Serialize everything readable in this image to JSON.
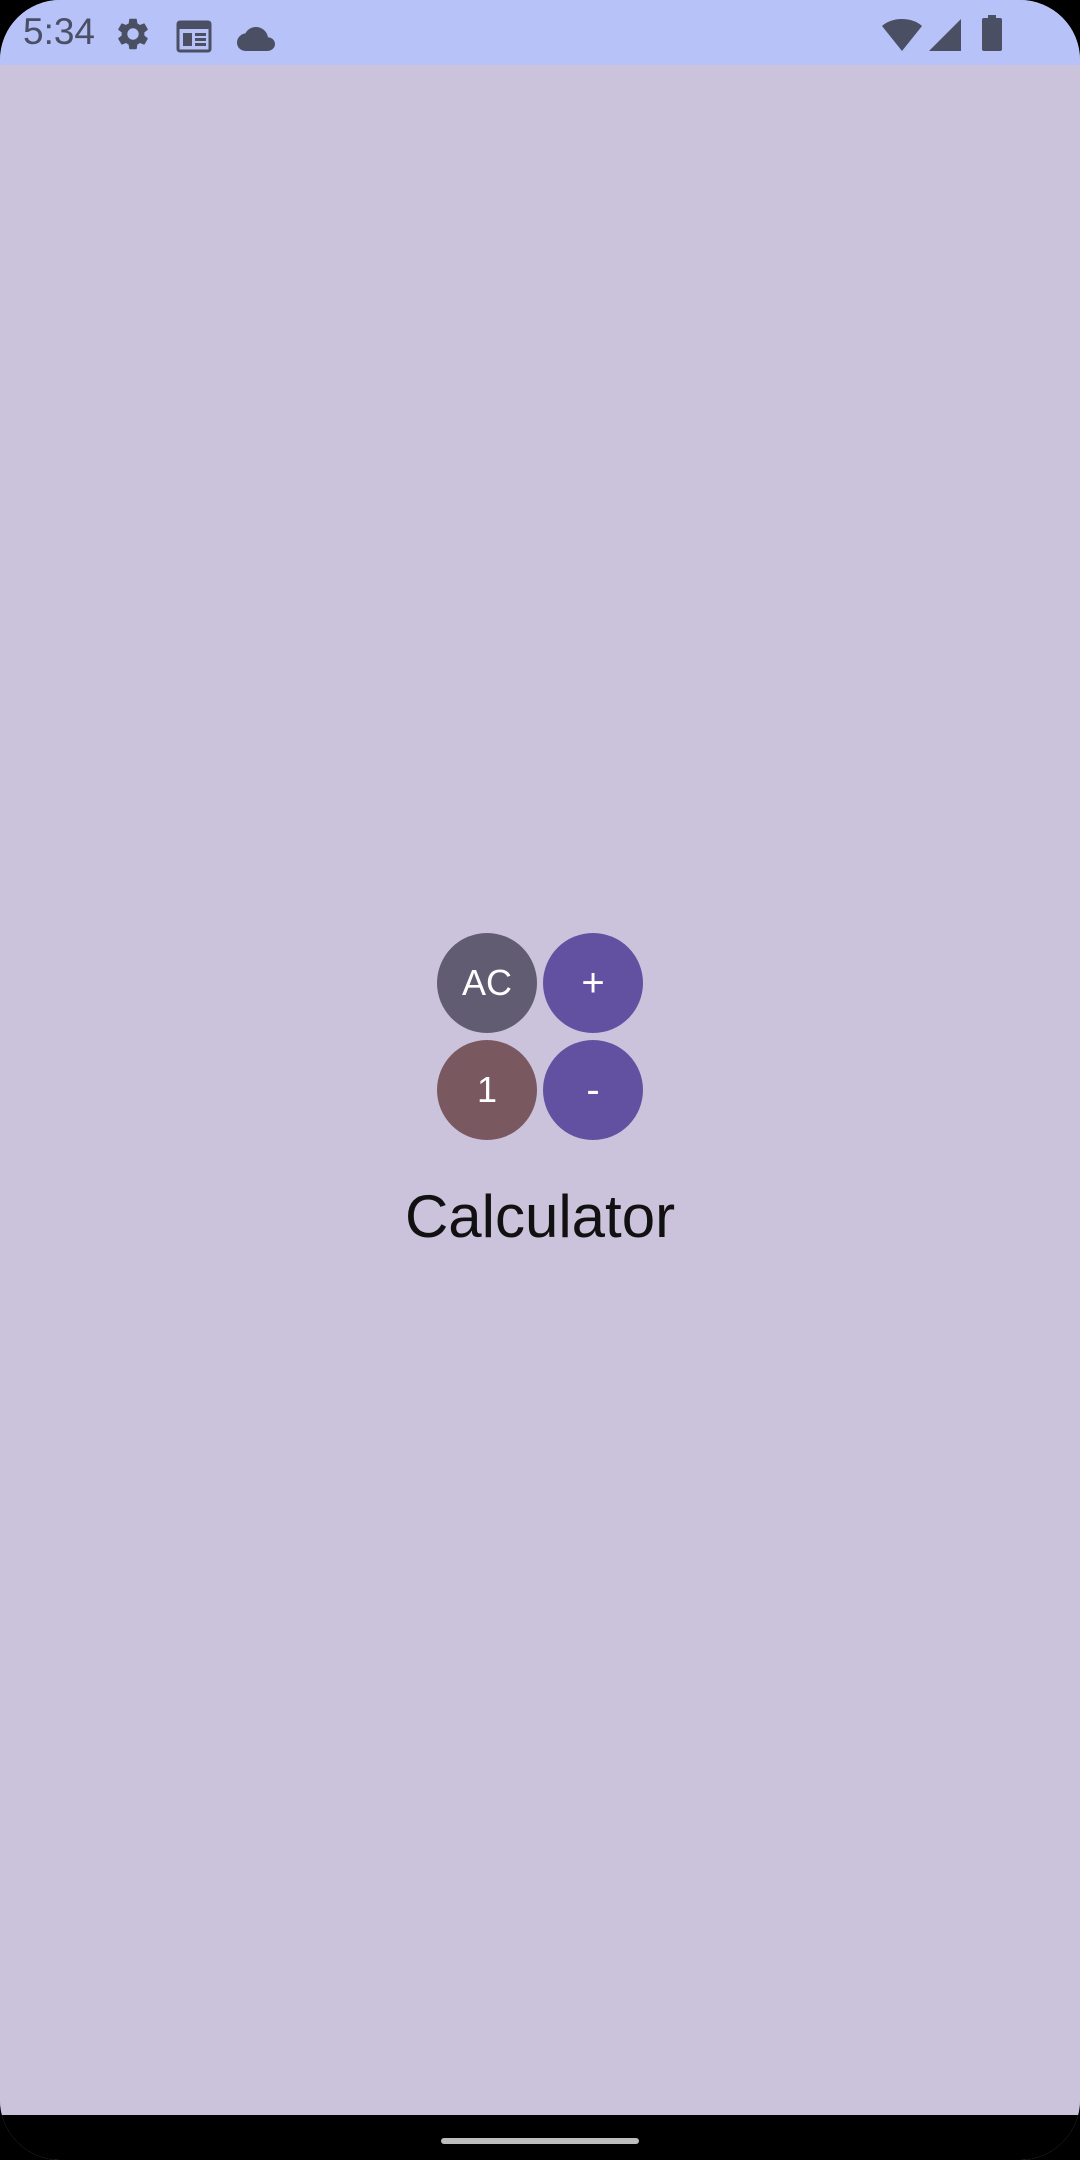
{
  "status_bar": {
    "time": "5:34",
    "icons": [
      "gear-icon",
      "calendar-icon",
      "cloud-icon",
      "wifi-icon",
      "signal-icon",
      "battery-icon"
    ]
  },
  "calculator": {
    "buttons": [
      {
        "label": "AC",
        "color": "#615C72"
      },
      {
        "label": "+",
        "color": "#6151A0"
      },
      {
        "label": "1",
        "color": "#7A5860"
      },
      {
        "label": "-",
        "color": "#6151A0"
      }
    ],
    "title": "Calculator"
  },
  "colors": {
    "background": "#CBC3DC",
    "status_bar": "#B6C2F8",
    "status_icons": "#4A4F63"
  }
}
